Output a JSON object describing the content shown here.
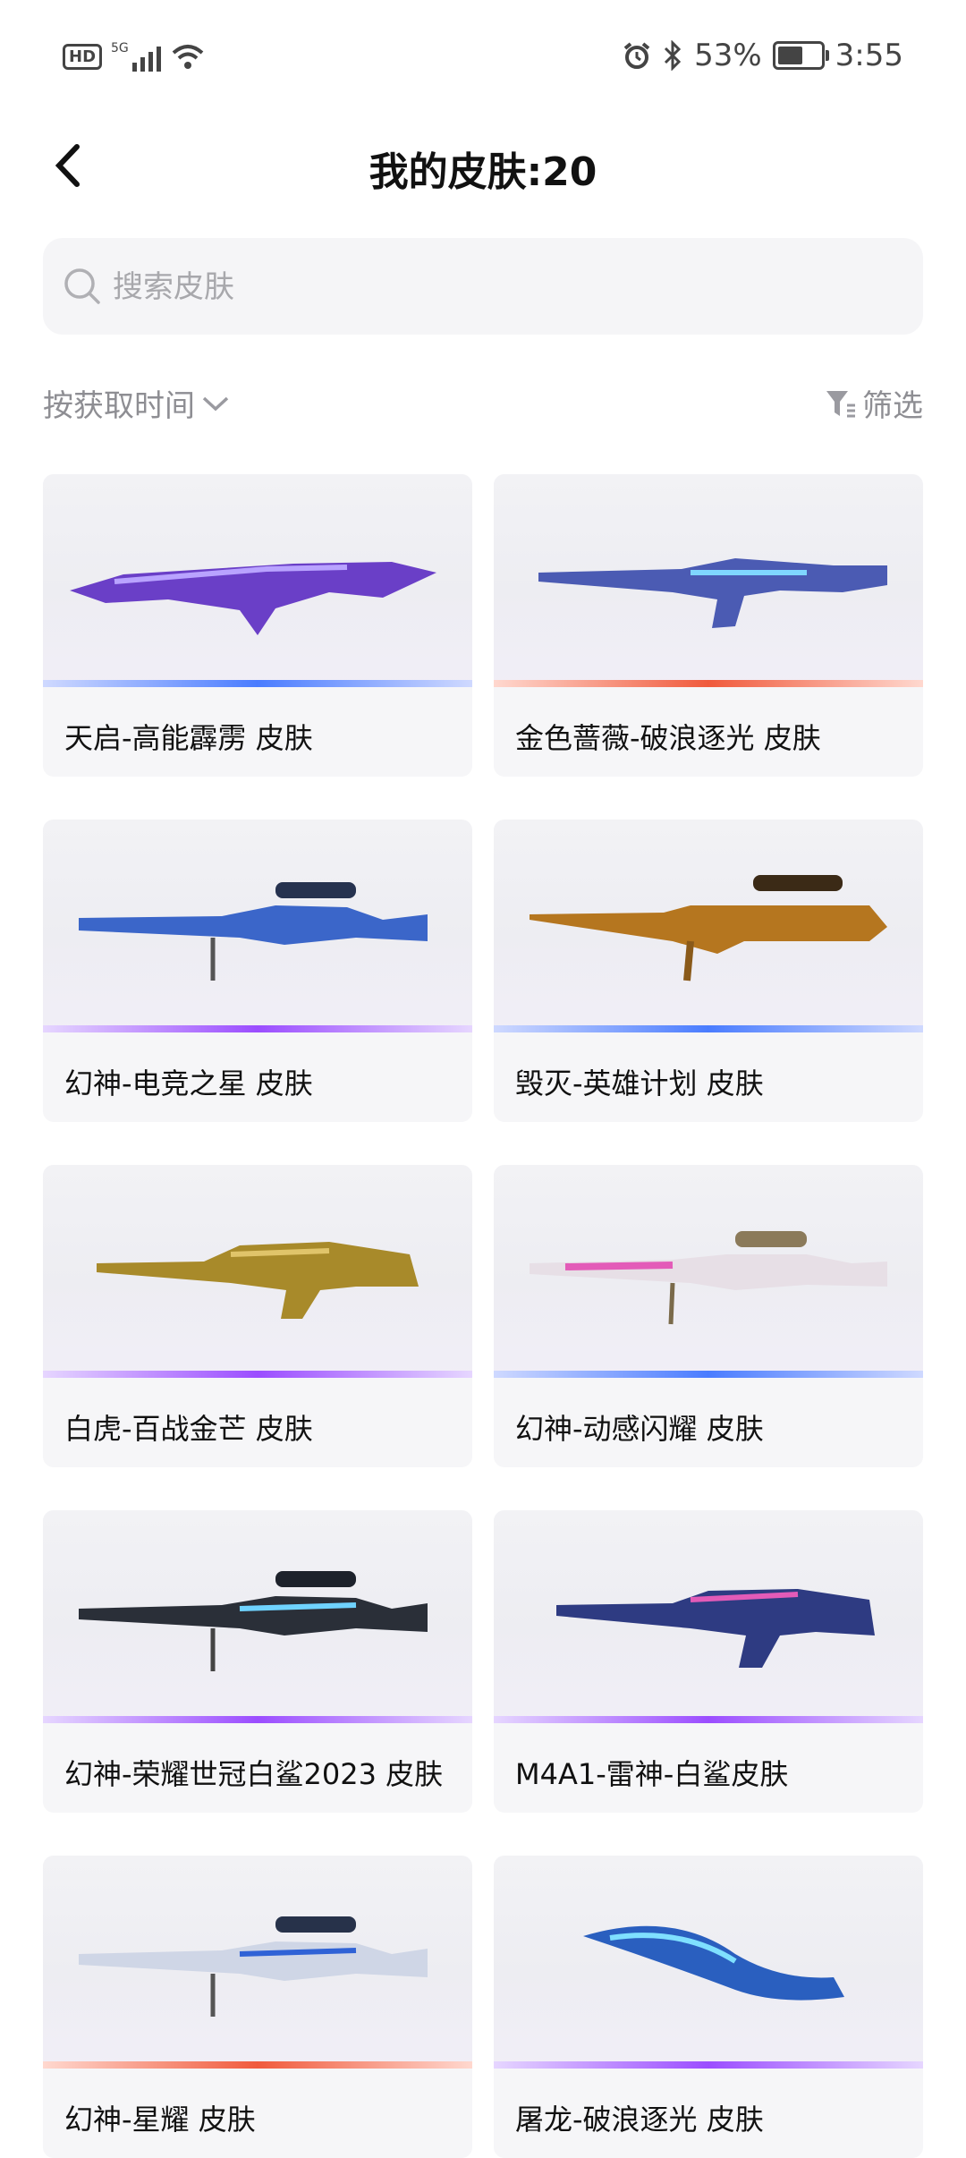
{
  "status": {
    "signal": "5G",
    "hd": "HD",
    "battery": "53%",
    "time": "3:55"
  },
  "header": {
    "title": "我的皮肤:20"
  },
  "search": {
    "placeholder": "搜索皮肤"
  },
  "toolbar": {
    "sort_label": "按获取时间",
    "filter_label": "筛选"
  },
  "skins": [
    {
      "name": "天启-高能霹雳 皮肤",
      "accent": "#4a7cff"
    },
    {
      "name": "金色蔷薇-破浪逐光 皮肤",
      "accent": "#f05a3c"
    },
    {
      "name": "幻神-电竞之星 皮肤",
      "accent": "#9b4dff"
    },
    {
      "name": "毁灭-英雄计划 皮肤",
      "accent": "#4a7cff"
    },
    {
      "name": "白虎-百战金芒 皮肤",
      "accent": "#9b4dff"
    },
    {
      "name": "幻神-动感闪耀 皮肤",
      "accent": "#4a7cff"
    },
    {
      "name": "幻神-荣耀世冠白鲨2023 皮肤",
      "accent": "#9b4dff"
    },
    {
      "name": "M4A1-雷神-白鲨皮肤",
      "accent": "#9b4dff"
    },
    {
      "name": "幻神-星耀 皮肤",
      "accent": "#f05a3c"
    },
    {
      "name": "屠龙-破浪逐光 皮肤",
      "accent": "#9b4dff"
    }
  ]
}
